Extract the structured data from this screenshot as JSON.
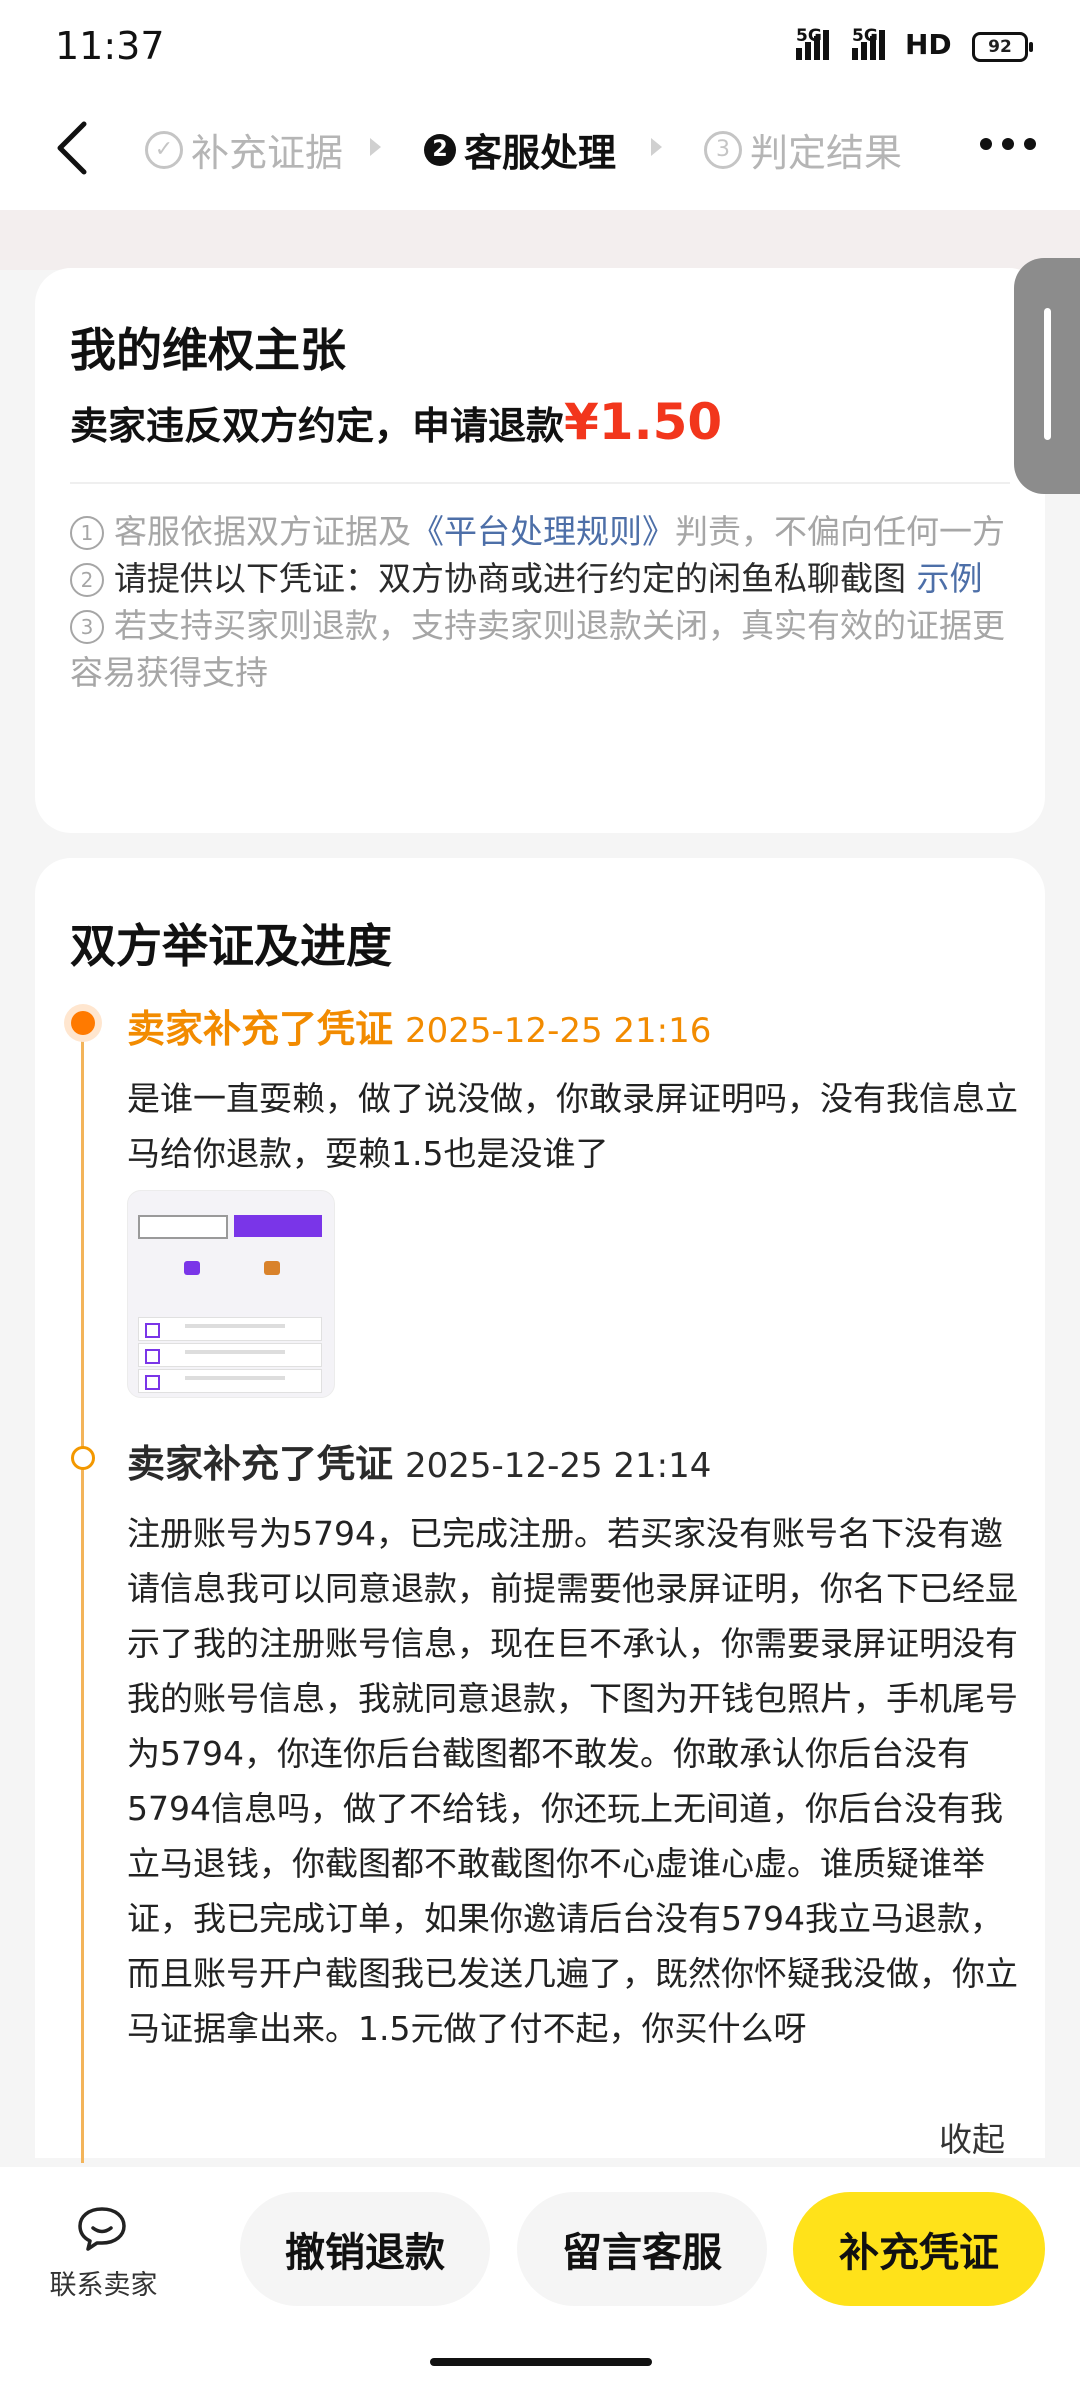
{
  "status_bar": {
    "time": "11:37",
    "signal1": "5G",
    "signal2": "5G",
    "network": "HD",
    "battery": "92"
  },
  "header": {
    "steps": [
      {
        "num": "✓",
        "label": "补充证据"
      },
      {
        "num": "2",
        "label": "客服处理"
      },
      {
        "num": "3",
        "label": "判定结果"
      }
    ]
  },
  "claim_card": {
    "title": "我的维权主张",
    "claim_text": "卖家违反双方约定，申请退款",
    "amount": "¥1.50",
    "notes": {
      "n1_num": "1",
      "n1_pre": "客服依据双方证据及",
      "n1_link": "《平台处理规则》",
      "n1_post": "判责，不偏向任何一方",
      "n2_num": "2",
      "n2_text": "请提供以下凭证：双方协商或进行约定的闲鱼私聊截图",
      "n2_link": "示例",
      "n3_num": "3",
      "n3_text": "若支持买家则退款，支持卖家则退款关闭，真实有效的证据更容易获得支持"
    }
  },
  "progress_card": {
    "title": "双方举证及进度",
    "events": [
      {
        "who": "卖家补充了凭证",
        "time": "2025-12-25 21:16",
        "text": "是谁一直耍赖，做了说没做，你敢录屏证明吗，没有我信息立马给你退款，耍赖1.5也是没谁了"
      },
      {
        "who": "卖家补充了凭证",
        "time": "2025-12-25 21:14",
        "text": "注册账号为5794，已完成注册。若买家没有账号名下没有邀请信息我可以同意退款，前提需要他录屏证明，你名下已经显示了我的注册账号信息，现在巨不承认，你需要录屏证明没有我的账号信息，我就同意退款，下图为开钱包照片，手机尾号为5794，你连你后台截图都不敢发。你敢承认你后台没有5794信息吗，做了不给钱，你还玩上无间道，你后台没有我立马退钱，你截图都不敢截图你不心虚谁心虚。谁质疑谁举证，我已完成订单，如果你邀请后台没有5794我立马退款，而且账号开户截图我已发送几遍了，既然你怀疑我没做，你立马证据拿出来。1.5元做了付不起，你买什么呀"
      }
    ],
    "collapse_label": "收起"
  },
  "bottom_bar": {
    "contact_label": "联系卖家",
    "cancel_label": "撤销退款",
    "message_label": "留言客服",
    "add_label": "补充凭证"
  },
  "colors": {
    "accent_orange": "#f28b00",
    "price_red": "#f2361c",
    "primary_yellow": "#ffe21a",
    "link_blue": "#4d6fa8"
  }
}
